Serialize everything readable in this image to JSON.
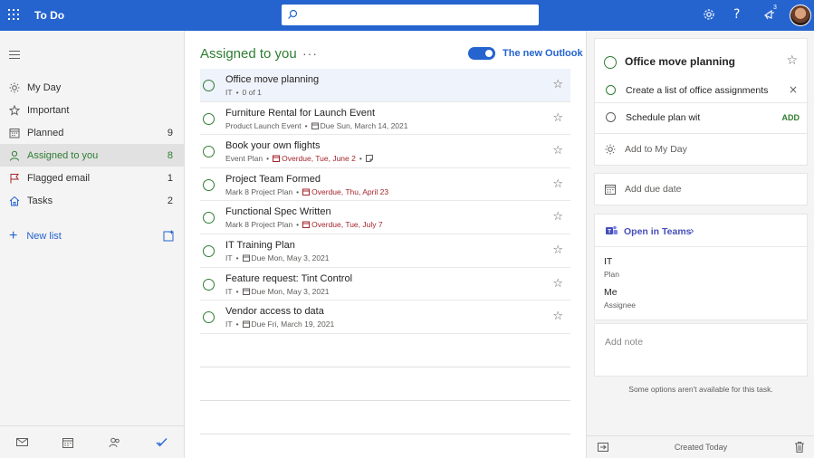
{
  "app": {
    "title": "To Do"
  },
  "search": {
    "placeholder": ""
  },
  "topbar": {
    "notification_count": "3"
  },
  "sidebar": {
    "items": [
      {
        "label": "My Day",
        "count": "",
        "icon": "sun-icon"
      },
      {
        "label": "Important",
        "count": "",
        "icon": "star-icon"
      },
      {
        "label": "Planned",
        "count": "9",
        "icon": "calendar-icon"
      },
      {
        "label": "Assigned to you",
        "count": "8",
        "icon": "person-icon"
      },
      {
        "label": "Flagged email",
        "count": "1",
        "icon": "flag-icon"
      },
      {
        "label": "Tasks",
        "count": "2",
        "icon": "home-icon"
      }
    ],
    "new_list_label": "New list"
  },
  "main": {
    "title": "Assigned to you",
    "more": "···",
    "toggle_label": "The new Outlook",
    "tasks": [
      {
        "title": "Office move planning",
        "list": "IT",
        "extra": "0 of 1",
        "due": "",
        "overdue": false,
        "note": false
      },
      {
        "title": "Furniture Rental for Launch Event",
        "list": "Product Launch Event",
        "extra": "",
        "due": "Due Sun, March 14, 2021",
        "overdue": false,
        "note": false
      },
      {
        "title": "Book your own flights",
        "list": "Event Plan",
        "extra": "",
        "due": "Overdue, Tue, June 2",
        "overdue": true,
        "note": true
      },
      {
        "title": "Project Team Formed",
        "list": "Mark 8 Project Plan",
        "extra": "",
        "due": "Overdue, Thu, April 23",
        "overdue": true,
        "note": false
      },
      {
        "title": "Functional Spec Written",
        "list": "Mark 8 Project Plan",
        "extra": "",
        "due": "Overdue, Tue, July 7",
        "overdue": true,
        "note": false
      },
      {
        "title": "IT Training Plan",
        "list": "IT",
        "extra": "",
        "due": "Due Mon, May 3, 2021",
        "overdue": false,
        "note": false
      },
      {
        "title": "Feature request: Tint Control",
        "list": "IT",
        "extra": "",
        "due": "Due Mon, May 3, 2021",
        "overdue": false,
        "note": false
      },
      {
        "title": "Vendor access to data",
        "list": "IT",
        "extra": "",
        "due": "Due Fri, March 19, 2021",
        "overdue": false,
        "note": false
      }
    ]
  },
  "detail": {
    "title": "Office move planning",
    "steps": [
      {
        "text": "Create a list of office assignments"
      }
    ],
    "new_step_value": "Schedule plan wit",
    "add_label": "ADD",
    "my_day_label": "Add to My Day",
    "due_label": "Add due date",
    "teams_label": "Open in Teams",
    "plan_value": "IT",
    "plan_key": "Plan",
    "assignee_value": "Me",
    "assignee_key": "Assignee",
    "note_placeholder": "Add note",
    "notice": "Some options aren't available for this task.",
    "created": "Created Today"
  }
}
